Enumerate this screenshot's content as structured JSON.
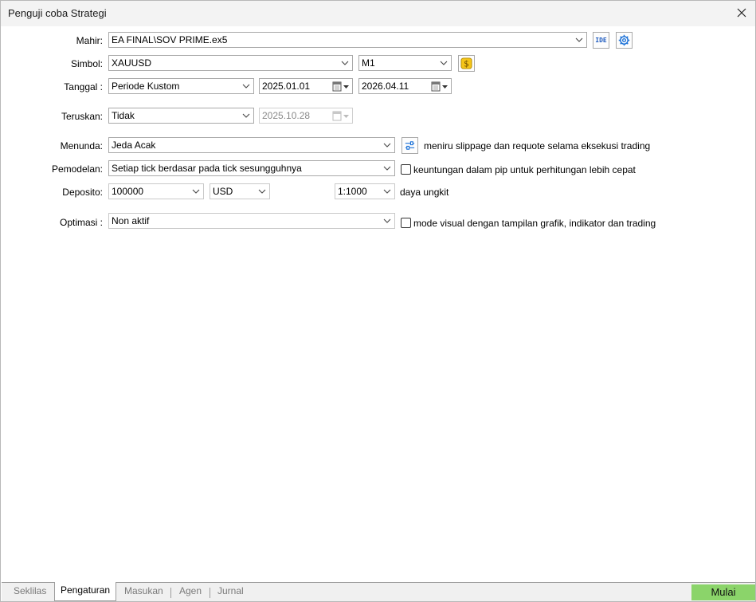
{
  "window": {
    "title": "Penguji coba Strategi"
  },
  "form": {
    "expert": {
      "label": "Mahir:",
      "value": "EA FINAL\\SOV PRIME.ex5"
    },
    "symbol": {
      "label": "Simbol:",
      "value": "XAUUSD",
      "timeframe": "M1"
    },
    "date": {
      "label": "Tanggal :",
      "period": "Periode Kustom",
      "from": "2025.01.01",
      "to": "2026.04.11"
    },
    "forward": {
      "label": "Teruskan:",
      "value": "Tidak",
      "date": "2025.10.28"
    },
    "delay": {
      "label": "Menunda:",
      "value": "Jeda Acak",
      "note": "meniru slippage dan requote selama eksekusi trading"
    },
    "modeling": {
      "label": "Pemodelan:",
      "value": "Setiap tick berdasar pada tick sesungguhnya",
      "checkbox_label": "keuntungan dalam pip untuk perhitungan lebih cepat"
    },
    "deposit": {
      "label": "Deposito:",
      "amount": "100000",
      "currency": "USD",
      "leverage": "1:1000",
      "leverage_label": "daya ungkit"
    },
    "optimization": {
      "label": "Optimasi :",
      "value": "Non aktif",
      "checkbox_label": "mode visual dengan tampilan grafik, indikator dan trading"
    }
  },
  "buttons": {
    "ide": "IDE"
  },
  "tabs": [
    {
      "label": "Seklilas"
    },
    {
      "label": "Pengaturan"
    },
    {
      "label": "Masukan"
    },
    {
      "label": "Agen"
    },
    {
      "label": "Jurnal"
    }
  ],
  "start_button": "Mulai",
  "colors": {
    "accent_green": "#8bd46a",
    "dollar_icon": "#f5c518",
    "settings_icon": "#1e73d8"
  }
}
